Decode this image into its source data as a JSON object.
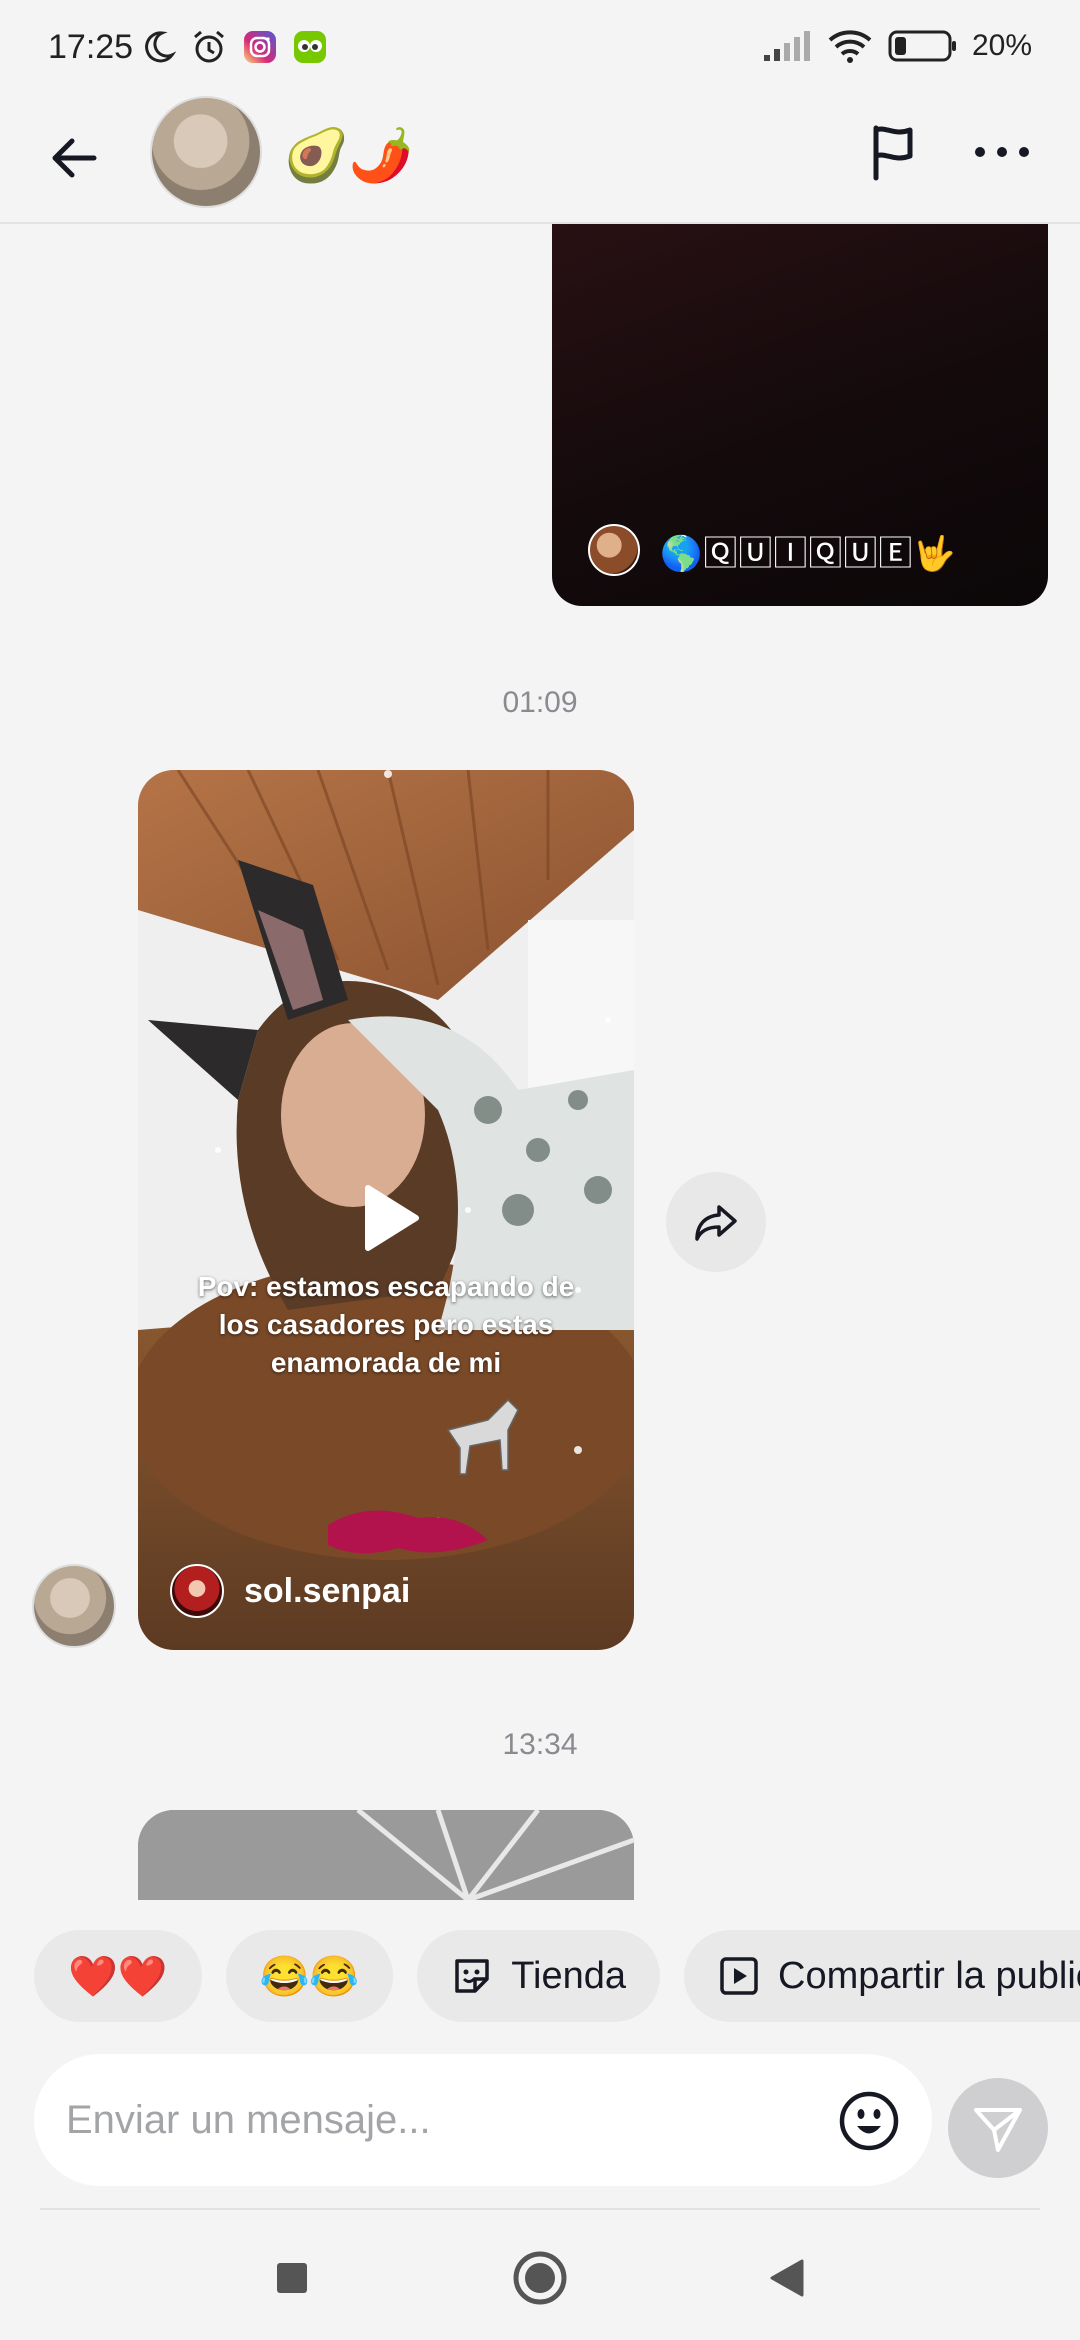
{
  "status_bar": {
    "time": "17:25",
    "battery_percent": "20%",
    "left_icons": [
      "moon-icon",
      "alarm-icon",
      "instagram-icon",
      "duolingo-icon"
    ],
    "right_icons": [
      "signal-icon",
      "wifi-icon",
      "battery-icon"
    ]
  },
  "header": {
    "contact_name": "🥑🌶️",
    "actions": [
      "flag-icon",
      "more-icon"
    ]
  },
  "messages": [
    {
      "type": "video",
      "side": "right",
      "author": "🌎🅀🅄🄸🅀🅄🄴🤟"
    },
    {
      "type": "timestamp",
      "text": "01:09"
    },
    {
      "type": "video",
      "side": "left",
      "caption": "Pov: estamos escapando de los casadores pero estas enamorada de mi",
      "author": "sol.senpai"
    },
    {
      "type": "timestamp",
      "text": "13:34"
    }
  ],
  "quick_replies": [
    {
      "label": "❤️❤️"
    },
    {
      "label": "😂😂"
    },
    {
      "label": "Tienda",
      "icon": "sticker-icon"
    },
    {
      "label": "Compartir la publicación",
      "icon": "play-square-icon"
    }
  ],
  "composer": {
    "placeholder": "Enviar un mensaje...",
    "value": ""
  },
  "colors": {
    "background": "#f4f4f4",
    "bubble": "#e9e9e9",
    "timestamp": "#8a8b91",
    "send_button": "#cfcfd1"
  }
}
